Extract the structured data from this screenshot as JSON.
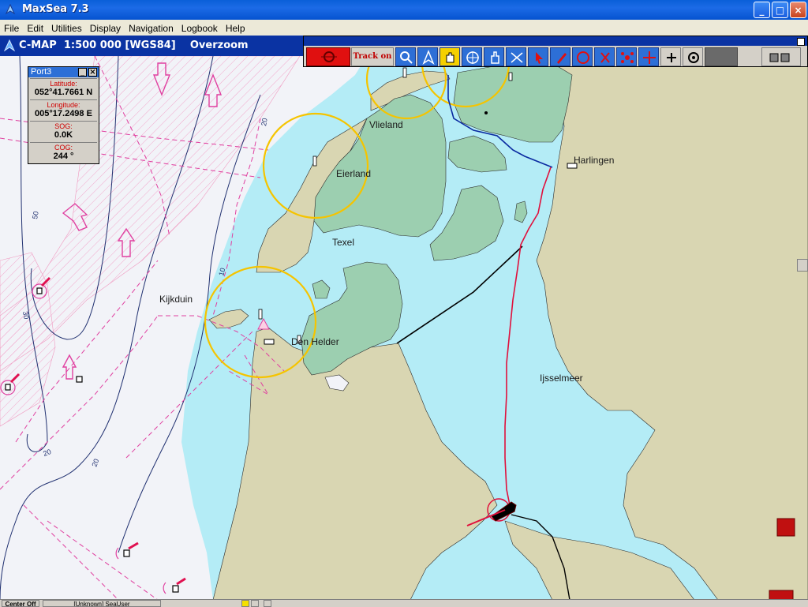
{
  "window": {
    "title": "MaxSea 7.3",
    "minimize": "_",
    "maximize": "□",
    "close": "×"
  },
  "menu": [
    "File",
    "Edit",
    "Utilities",
    "Display",
    "Navigation",
    "Logbook",
    "Help"
  ],
  "chart_header": {
    "source": "C-MAP",
    "scale": "1:500 000",
    "datum": "[WGS84]",
    "mode": "Overzoom"
  },
  "toolbar": {
    "track_label": "Track on",
    "tools": [
      "target-icon",
      "track-on",
      "magnifier-icon",
      "compass-icon",
      "hand-icon",
      "crosshair-icon",
      "pointing-hand-icon",
      "measure-icon",
      "cursor-arrow-icon",
      "pencil-icon",
      "route-icon",
      "scissors-icon",
      "cluster-icon",
      "move-icon",
      "plus-icon",
      "center-icon",
      "display-icon"
    ]
  },
  "port_panel": {
    "title": "Port3",
    "minimize": "_",
    "close": "×",
    "rows": [
      {
        "label": "Latitude:",
        "value": "052°41.7661 N"
      },
      {
        "label": "Longitude:",
        "value": "005°17.2498 E"
      },
      {
        "label": "SOG:",
        "value": "0.0K"
      },
      {
        "label": "COG:",
        "value": "244 °"
      }
    ]
  },
  "places": {
    "vlieland": "Vlieland",
    "eierland": "Eierland",
    "texel": "Texel",
    "kijkduin": "Kijkduin",
    "den_helder": "Den Helder",
    "harlingen": "Harlingen",
    "ijsselmeer": "Ijsselmeer"
  },
  "depths": {
    "d20a": "20",
    "d20b": "20",
    "d20c": "20",
    "d30": "30",
    "d50": "50",
    "d10": "10"
  },
  "statusbar": {
    "center": "Center Off",
    "user": "[Unknown] SeaUser"
  },
  "colors": {
    "land": "#d9d6b2",
    "shallow": "#b4ecf6",
    "marsh": "#9ccfb0",
    "deep": "#f2f3f8",
    "track": "#e0103c",
    "route": "#0a2aa0",
    "range_ring": "#f5c400",
    "traffic": "#e040a0"
  }
}
